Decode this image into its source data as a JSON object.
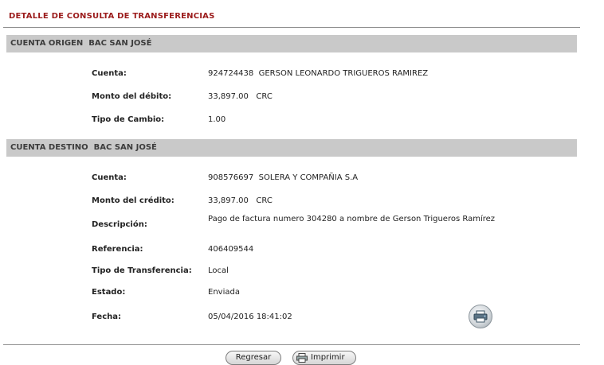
{
  "page": {
    "title": "DETALLE DE CONSULTA DE TRANSFERENCIAS"
  },
  "origin": {
    "header": "CUENTA ORIGEN  BAC SAN JOSÉ",
    "fields": [
      {
        "label": "Cuenta:",
        "value": "924724438  GERSON LEONARDO TRIGUEROS RAMIREZ"
      },
      {
        "label": "Monto del débito:",
        "value": "33,897.00   CRC"
      },
      {
        "label": "Tipo de Cambio:",
        "value": "1.00"
      }
    ]
  },
  "destination": {
    "header": "CUENTA DESTINO  BAC SAN JOSÉ",
    "fields": [
      {
        "label": "Cuenta:",
        "value": "908576697  SOLERA Y COMPAÑIA S.A"
      },
      {
        "label": "Monto del crédito:",
        "value": "33,897.00   CRC"
      },
      {
        "label": "Descripción:",
        "value": "Pago de factura numero 304280 a nombre de Gerson Trigueros Ramírez"
      },
      {
        "label": "Referencia:",
        "value": "406409544"
      },
      {
        "label": "Tipo de Transferencia:",
        "value": "Local"
      },
      {
        "label": "Estado:",
        "value": "Enviada"
      },
      {
        "label": "Fecha:",
        "value": "05/04/2016 18:41:02"
      }
    ]
  },
  "actions": {
    "print_icon": "printer-icon",
    "back_label": "Regresar",
    "print_label": "Imprimir"
  },
  "colors": {
    "title": "#9b1b1b",
    "section_header_bg": "#c9c9c9"
  }
}
